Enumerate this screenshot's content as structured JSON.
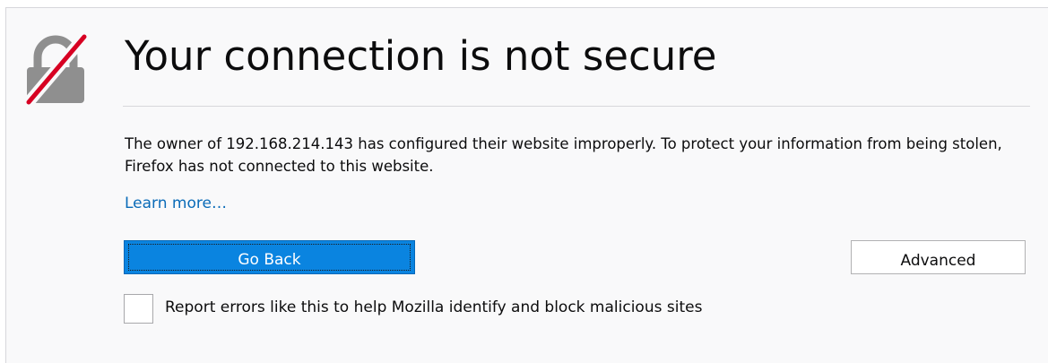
{
  "error_page": {
    "title": "Your connection is not secure",
    "description": "The owner of 192.168.214.143 has configured their website improperly. To protect your information from being stolen, Firefox has not connected to this website.",
    "learn_more": "Learn more…",
    "go_back_label": "Go Back",
    "advanced_label": "Advanced",
    "report_errors_label": "Report errors like this to help Mozilla identify and block malicious sites",
    "report_errors_checked": false,
    "icon": "broken-lock-icon"
  },
  "colors": {
    "background": "#f9f9fa",
    "primary_button": "#0a84e0",
    "link": "#0a6bb8",
    "icon_gray": "#8f8f8f",
    "icon_slash": "#d70022"
  }
}
